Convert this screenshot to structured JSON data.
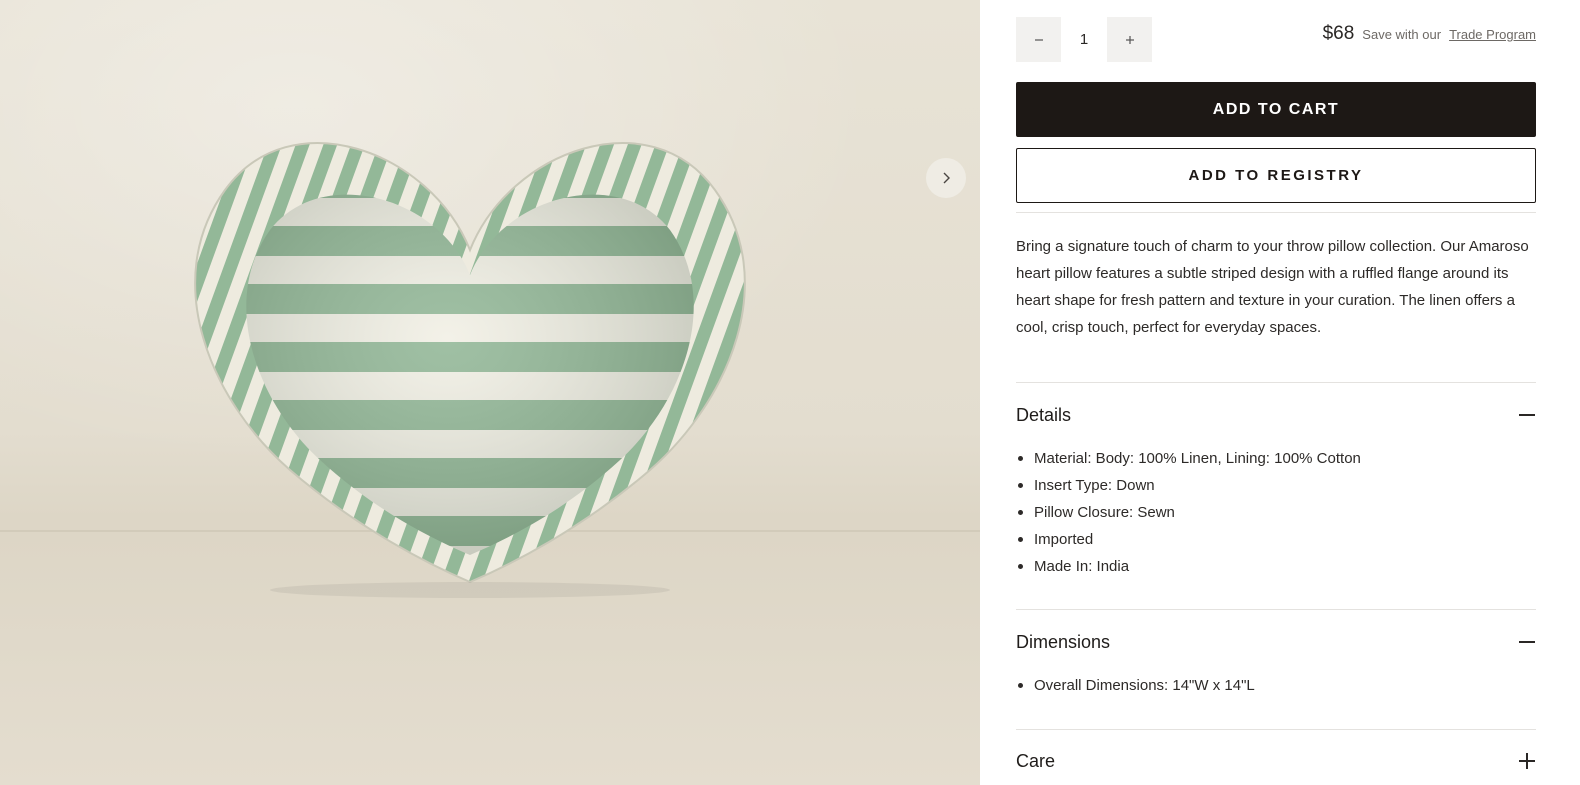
{
  "gallery": {
    "image_alt": "Striped green and white heart pillow with ruffled flange",
    "pillow_colors": {
      "stripe": "#8fb594",
      "base": "#f1efe4"
    }
  },
  "purchase": {
    "quantity": "1",
    "price": "$68",
    "trade_text": "Save with our",
    "trade_link": "Trade Program",
    "add_to_cart": "ADD TO CART",
    "add_to_registry": "ADD TO REGISTRY"
  },
  "description": "Bring a signature touch of charm to your throw pillow collection. Our Amaroso heart pillow features a subtle striped design with a ruffled flange around its heart shape for fresh pattern and texture in your curation. The linen offers a cool, crisp touch, perfect for everyday spaces.",
  "details": {
    "title": "Details",
    "state": "expanded",
    "items": [
      "Material: Body: 100% Linen, Lining: 100% Cotton",
      "Insert Type: Down",
      "Pillow Closure: Sewn",
      "Imported",
      "Made In: India"
    ]
  },
  "dimensions": {
    "title": "Dimensions",
    "state": "expanded",
    "items": [
      "Overall Dimensions: 14\"W x 14\"L"
    ]
  },
  "care": {
    "title": "Care",
    "state": "collapsed"
  },
  "colors": {
    "primary_button": "#1d1815",
    "divider": "#e4e2df",
    "qty_button_bg": "#f2f1ef"
  }
}
